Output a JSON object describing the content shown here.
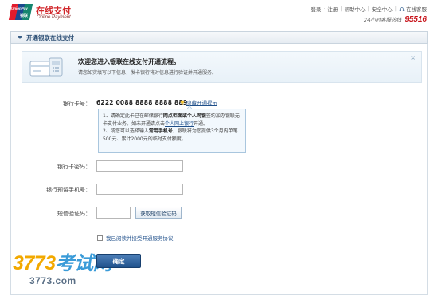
{
  "brand": {
    "logo_text": "UnionPay",
    "logo_sub": "银联",
    "title": "在线支付",
    "subtitle": "Online Payment"
  },
  "topnav": {
    "login": "登录",
    "register": "注册",
    "help": "帮助中心",
    "security": "安全中心",
    "online_service": "在线客服",
    "hotline_label": "24小时客服热线",
    "hotline_number": "95516"
  },
  "section": {
    "title": "开通银联在线支付"
  },
  "welcome": {
    "headline": "欢迎您进入银联在线支付开通流程。",
    "description": "请您如实填写以下信息，发卡银行将对信息进行验证并开通服务。",
    "close_icon": "×"
  },
  "form": {
    "card_number_label": "银行卡号：",
    "card_number_value": "6222 0088 8888 8888 889",
    "hide_tip_label": "隐藏开通提示",
    "tip": {
      "line1_a": "1、请确定此卡已在邮储银行",
      "line1_b": "网点柜面或个人网银",
      "line1_c": "签约加办银联无卡支付业务。如未开通请点击",
      "line1_link": "个人网上银行",
      "line1_d": "开通。",
      "line2_a": "2、或您可以选择输入",
      "line2_b": "常用手机号",
      "line2_c": "，银联将为您提供3个月内单笔500元、累计2000元的临时支付额度。"
    },
    "password_label": "银行卡密码：",
    "password_value": "",
    "phone_label": "银行预留手机号：",
    "phone_value": "",
    "sms_label": "短信验证码：",
    "sms_value": "",
    "sms_button": "获取短信验证码",
    "agree_label": "我已阅读并接受开通服务协议",
    "submit_label": "确定"
  },
  "watermark": {
    "line1_num": "3773",
    "line1_cn": "考试网",
    "line2": "3773.com"
  },
  "colors": {
    "brand_red": "#d1262a",
    "link_blue": "#1f4f8a",
    "button_blue": "#20528c",
    "hotline_red": "#c8161d"
  }
}
